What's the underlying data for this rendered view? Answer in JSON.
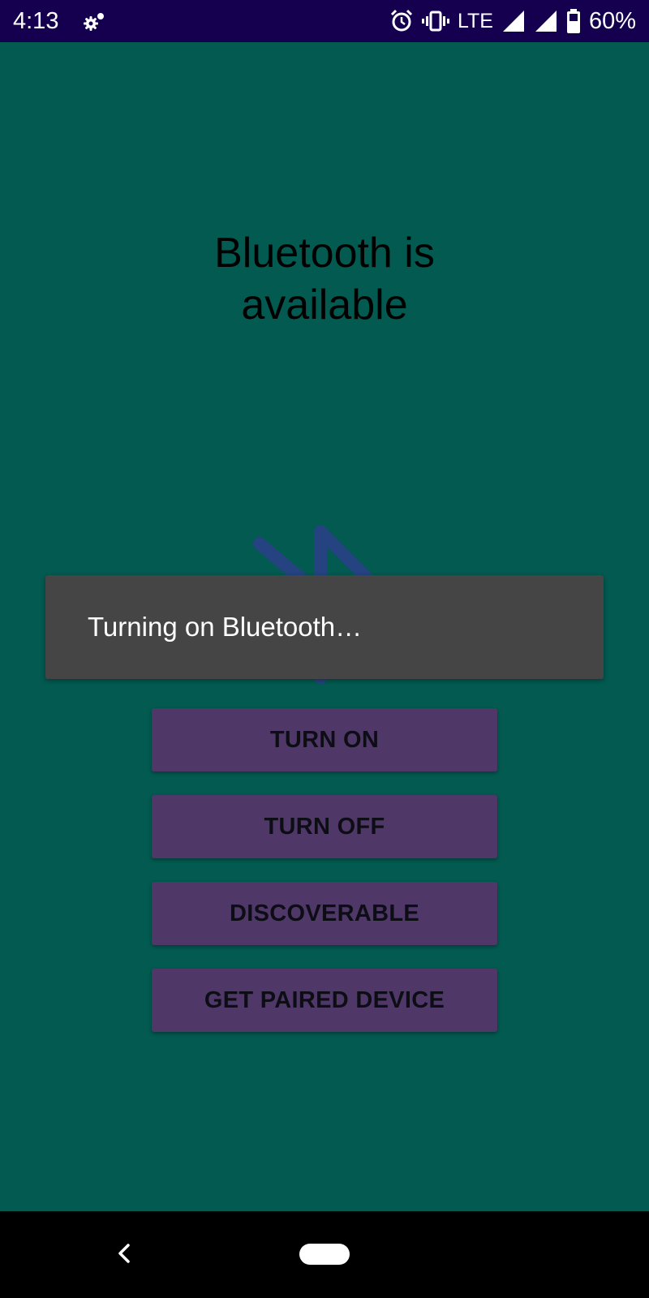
{
  "status_bar": {
    "time": "4:13",
    "network": "LTE",
    "battery": "60%",
    "background_color": "#150050",
    "icons": [
      "settings-icon",
      "alarm-icon",
      "vibrate-icon",
      "signal-icon",
      "signal-icon",
      "battery-icon"
    ]
  },
  "main": {
    "status_line1": "Bluetooth is",
    "status_line2": "available",
    "background_color": "#025a50",
    "image_icon": "bluetooth-icon"
  },
  "toast": {
    "message": "Turning on Bluetooth…"
  },
  "buttons": {
    "turn_on": "TURN ON",
    "turn_off": "TURN OFF",
    "discoverable": "DISCOVERABLE",
    "get_paired": "GET PAIRED DEVICE",
    "color": "#4f3868"
  },
  "nav_bar": {
    "icons": [
      "back-icon",
      "home-icon"
    ]
  }
}
